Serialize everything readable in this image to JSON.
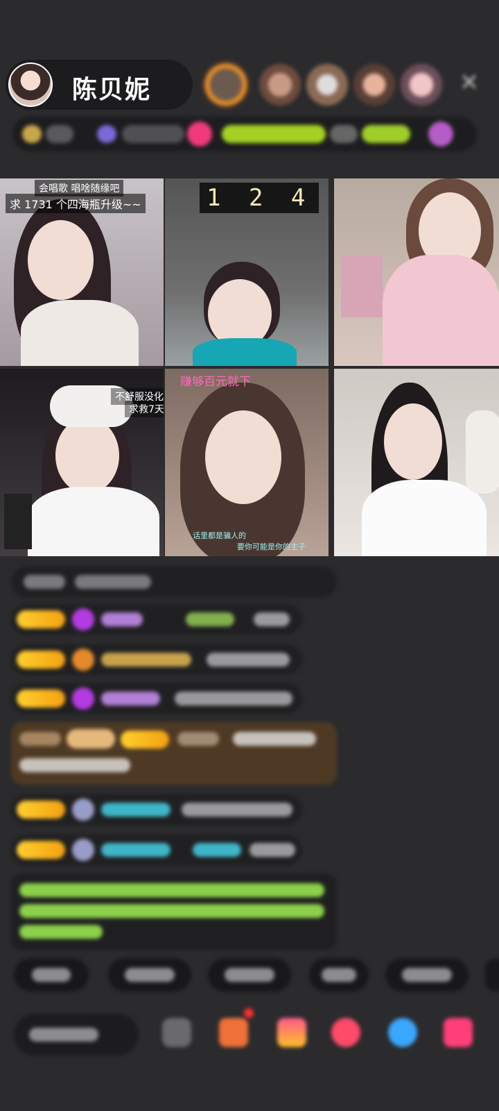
{
  "host": {
    "name": "陈贝妮"
  },
  "header": {
    "close_icon": "close-icon"
  },
  "grid": {
    "cells": [
      {
        "caption_top": "会唱歌    唱啥随缘吧",
        "caption_main": "求 1731 个四海瓶升级~~"
      },
      {
        "number": "1 2 4"
      },
      {},
      {
        "caption_top": "不舒服没化妆",
        "caption_main": "求救7天"
      },
      {
        "pink_caption": "赚够百元就下",
        "teal_line1": "话里都是骗人的",
        "teal_line2": "要你可能是你的主子"
      },
      {}
    ]
  },
  "colors": {
    "background": "#2b2b2d",
    "badge_gold": "#ffcf2e",
    "pink": "#ff6ab8",
    "green_text": "#8bd14a"
  }
}
